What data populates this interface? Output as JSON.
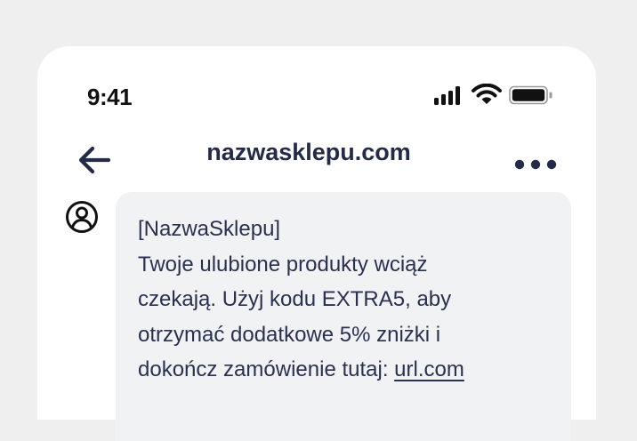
{
  "status_bar": {
    "time": "9:41",
    "icons": [
      "cellular-signal-icon",
      "wifi-icon",
      "battery-icon"
    ]
  },
  "header": {
    "title": "nazwasklepu.com",
    "back_icon": "arrow-left-icon",
    "menu_icon": "more-horizontal-icon"
  },
  "message": {
    "sender_icon": "user-circle-icon",
    "lines": [
      "[NazwaSklepu]",
      "Twoje ulubione produkty wciąż",
      "czekają. Użyj kodu EXTRA5, aby",
      "otrzymać dodatkowe 5% zniżki i"
    ],
    "last_line_prefix": "dokończ zamówienie tutaj: ",
    "link_text": "url.com"
  },
  "colors": {
    "background": "#efeff0",
    "phone": "#ffffff",
    "bubble": "#f1f2f4",
    "text": "#2a3150",
    "title": "#232b48"
  }
}
